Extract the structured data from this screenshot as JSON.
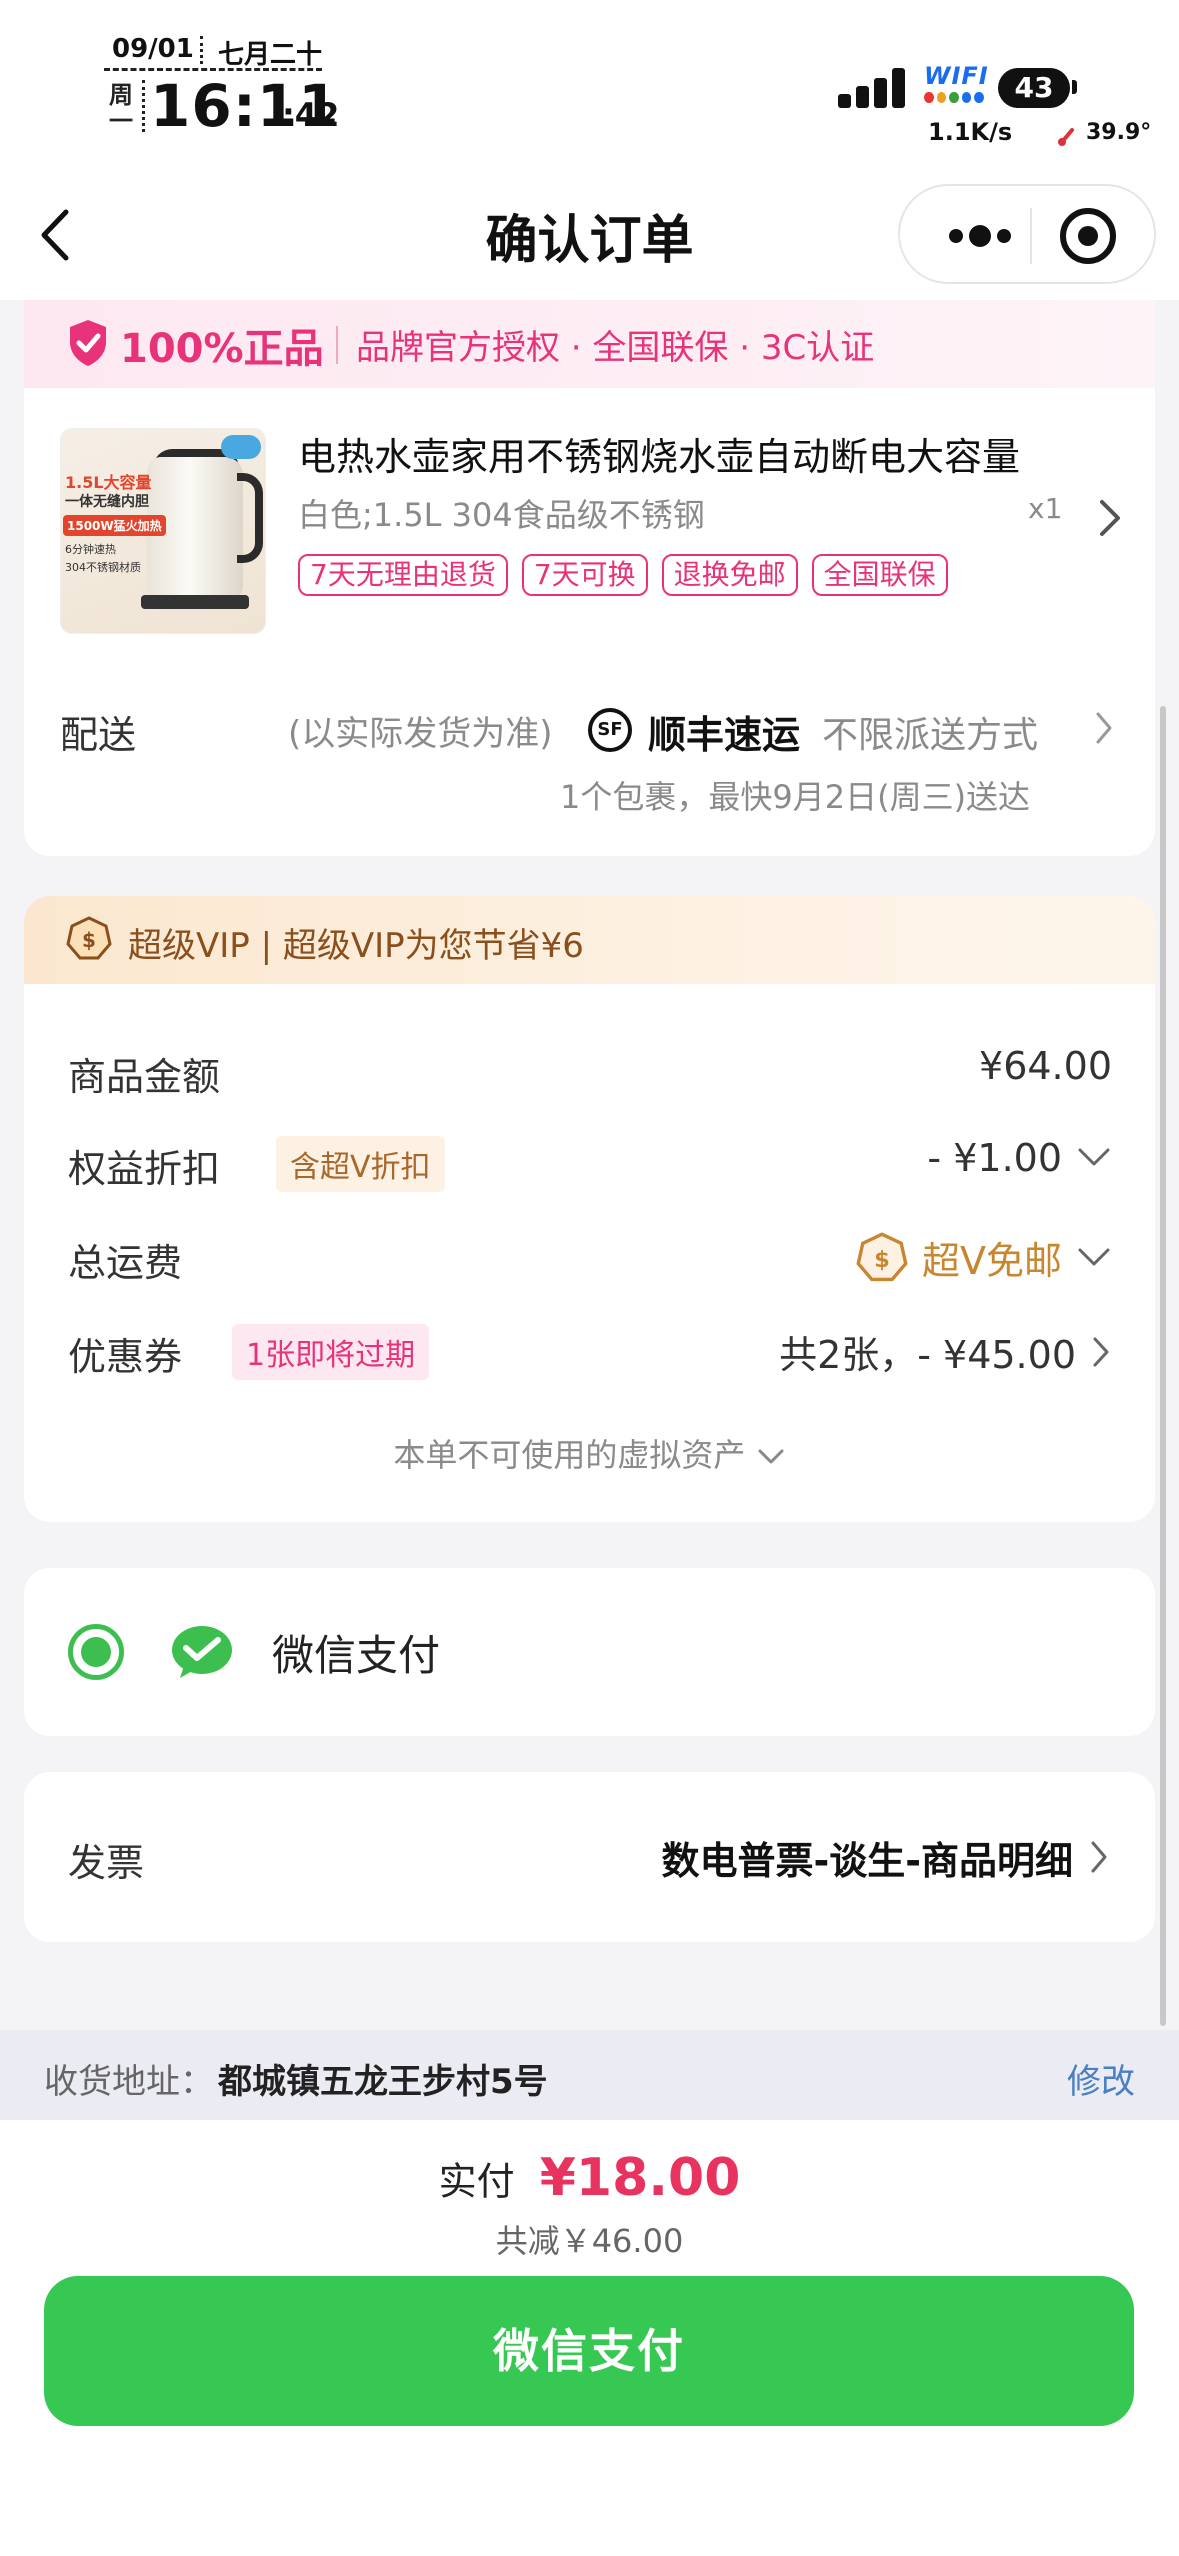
{
  "status_bar": {
    "date": "09/01",
    "lunar_date": "七月二十",
    "weekday": "周一",
    "time": "16:11",
    "seconds": ":42",
    "wifi_label": "WIFI",
    "battery": "43",
    "net_speed": "1.1K/s",
    "temperature": "39.9°"
  },
  "nav": {
    "title": "确认订单",
    "back_icon": "chevron-left-icon",
    "more_icon": "more-dots-icon",
    "close_icon": "target-circle-icon"
  },
  "genuine_banner": {
    "main": "100%正品",
    "sub": "品牌官方授权 · 全国联保 · 3C认证",
    "icon": "shield-check-icon"
  },
  "product": {
    "image_texts": [
      "1.5L大容量",
      "一体无缝内胆",
      "1500W猛火加热",
      "6分钟速热",
      "304不锈钢材质"
    ],
    "title": "电热水壶家用不锈钢烧水壶自动断电大容量",
    "spec": "白色;1.5L 304食品级不锈钢",
    "quantity": "x1",
    "tags": [
      "7天无理由退货",
      "7天可换",
      "退换免邮",
      "全国联保"
    ]
  },
  "shipping": {
    "label": "配送",
    "note": "(以实际发货为准)",
    "carrier_logo": "SF",
    "carrier": "顺丰速运",
    "mode": "不限派送方式",
    "eta": "1个包裹，最快9月2日(周三)送达"
  },
  "vip_banner": {
    "text": "超级VIP | 超级VIP为您节省¥6",
    "icon": "vip-coin-icon"
  },
  "price_rows": {
    "goods_label": "商品金额",
    "goods_value": "¥64.00",
    "discount_label": "权益折扣",
    "discount_chip": "含超V折扣",
    "discount_value": "- ¥1.00",
    "shipping_label": "总运费",
    "shipping_value": "超V免邮",
    "coupon_label": "优惠券",
    "coupon_chip": "1张即将过期",
    "coupon_value": "共2张，- ¥45.00",
    "asset_note": "本单不可使用的虚拟资产"
  },
  "payment": {
    "method": "微信支付",
    "selected": true,
    "icon": "wechat-pay-icon"
  },
  "invoice": {
    "label": "发票",
    "value": "数电普票-谈生-商品明细"
  },
  "address": {
    "label": "收货地址：",
    "value": "都城镇五龙王步村5号",
    "edit": "修改"
  },
  "footer": {
    "pay_label": "实付",
    "pay_amount": "¥18.00",
    "saved": "共减￥46.00",
    "button": "微信支付"
  },
  "colors": {
    "accent_pink": "#e8337a",
    "price_red": "#e8335e",
    "wechat_green": "#37c853",
    "vip_gold": "#c8862f"
  }
}
